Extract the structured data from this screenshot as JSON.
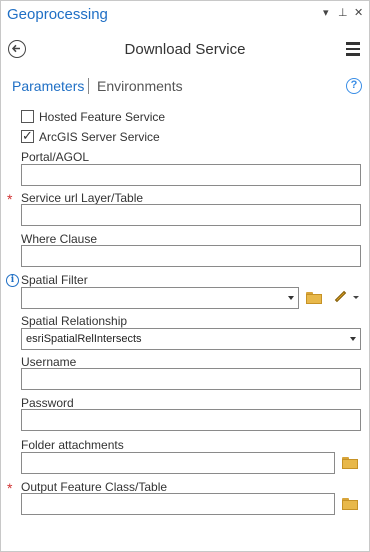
{
  "pane": {
    "title": "Geoprocessing",
    "controls": {
      "pin": "▾",
      "autohide": "⊥",
      "close": "✕"
    }
  },
  "tool": {
    "title": "Download Service"
  },
  "tabs": {
    "parameters": "Parameters",
    "environments": "Environments"
  },
  "icons": {
    "help": "?",
    "info": "i"
  },
  "form": {
    "hosted_feature_service": {
      "label": "Hosted Feature Service",
      "checked": false
    },
    "arcgis_server_service": {
      "label": "ArcGIS Server Service",
      "checked": true
    },
    "portal": {
      "label": "Portal/AGOL",
      "value": ""
    },
    "service_url": {
      "label": "Service url Layer/Table",
      "value": "",
      "required": true
    },
    "where_clause": {
      "label": "Where Clause",
      "value": ""
    },
    "spatial_filter": {
      "label": "Spatial Filter",
      "value": ""
    },
    "spatial_relationship": {
      "label": "Spatial Relationship",
      "value": "esriSpatialRelIntersects"
    },
    "username": {
      "label": "Username",
      "value": ""
    },
    "password": {
      "label": "Password",
      "value": ""
    },
    "folder_attachments": {
      "label": "Folder attachments",
      "value": ""
    },
    "output_feature_class": {
      "label": "Output Feature Class/Table",
      "value": "",
      "required": true
    }
  },
  "required_marker": "*",
  "colors": {
    "accent": "#1f6fc5",
    "required": "#d03030",
    "folder": "#e8b84a"
  }
}
